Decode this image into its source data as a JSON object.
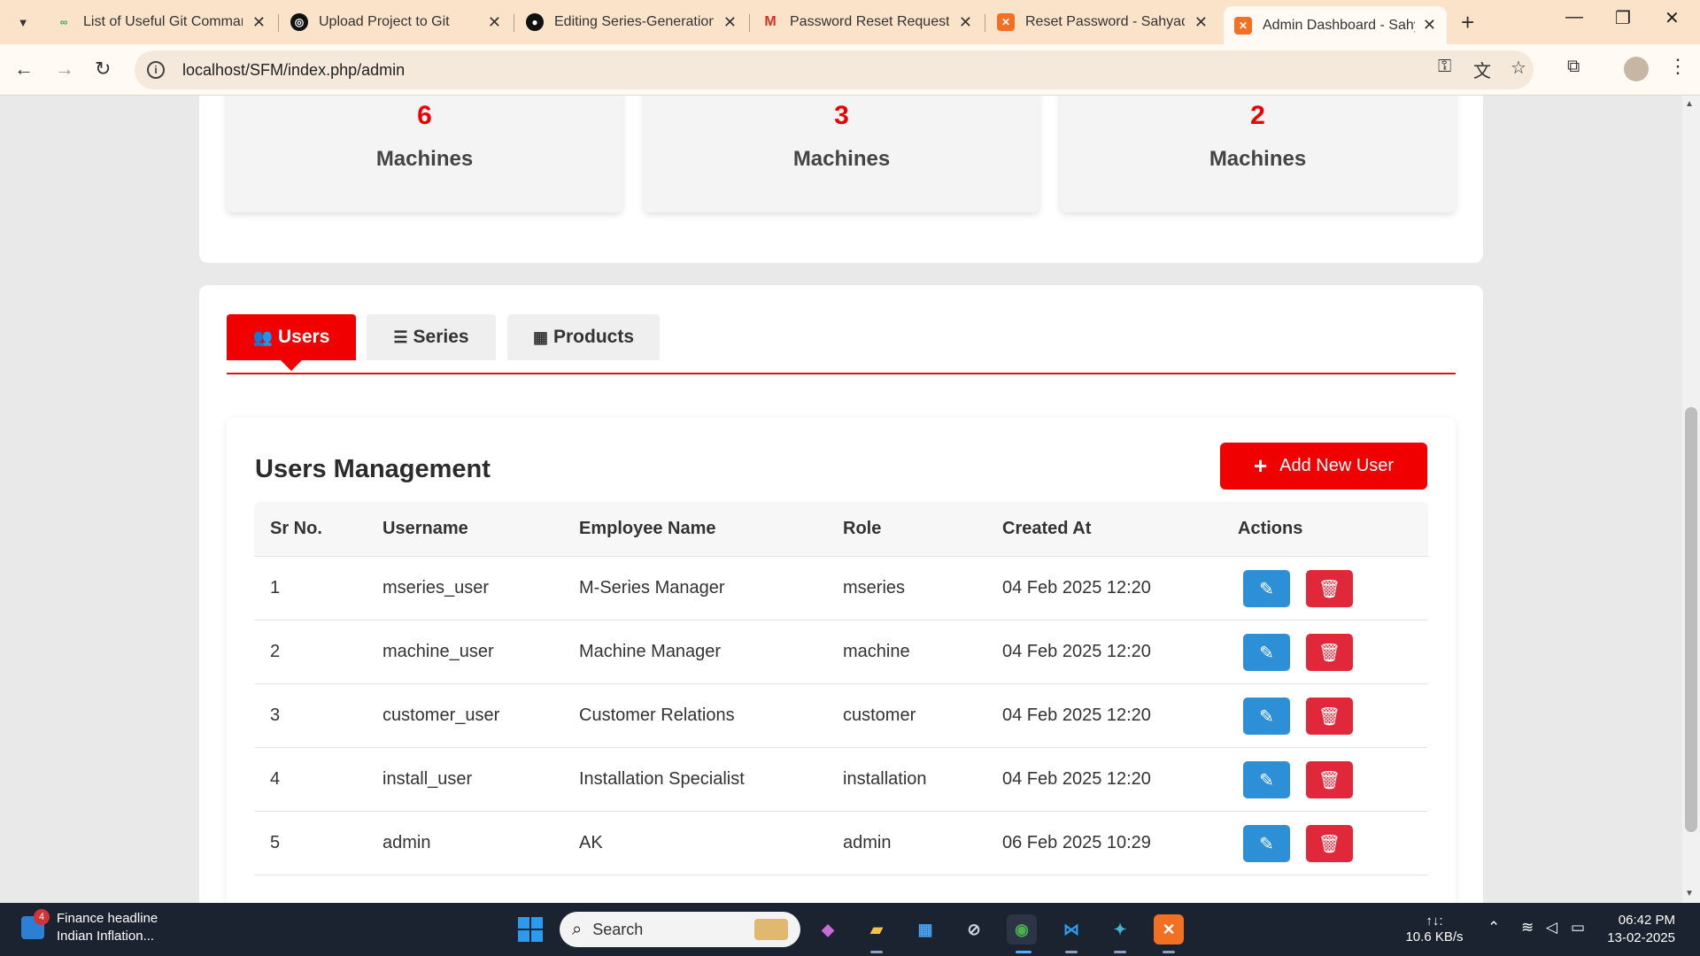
{
  "browser": {
    "tabs": [
      {
        "title": "List of Useful Git Commands",
        "favicon": "git-icon",
        "color": "#3aa35b"
      },
      {
        "title": "Upload Project to Git",
        "favicon": "openai-icon",
        "color": "#111111"
      },
      {
        "title": "Editing Series-Generation-",
        "favicon": "github-icon",
        "color": "#111111"
      },
      {
        "title": "Password Reset Request - ",
        "favicon": "gmail-icon",
        "color": "#d93025"
      },
      {
        "title": "Reset Password - Sahyadri",
        "favicon": "xampp-icon",
        "color": "#f36f21"
      },
      {
        "title": "Admin Dashboard - Sahyadri",
        "favicon": "xampp-icon",
        "color": "#f36f21",
        "active": true
      }
    ],
    "url": "localhost/SFM/index.php/admin"
  },
  "stats": [
    {
      "number": "6",
      "label": "Machines"
    },
    {
      "number": "3",
      "label": "Machines"
    },
    {
      "number": "2",
      "label": "Machines"
    }
  ],
  "page_tabs": [
    {
      "label": "Users",
      "icon": "users-icon",
      "active": true
    },
    {
      "label": "Series",
      "icon": "list-icon",
      "active": false
    },
    {
      "label": "Products",
      "icon": "box-icon",
      "active": false
    }
  ],
  "users": {
    "title": "Users Management",
    "add_button": "Add New User",
    "columns": [
      "Sr No.",
      "Username",
      "Employee Name",
      "Role",
      "Created At",
      "Actions"
    ],
    "rows": [
      {
        "sr": "1",
        "username": "mseries_user",
        "name": "M-Series Manager",
        "role": "mseries",
        "created": "04 Feb 2025 12:20"
      },
      {
        "sr": "2",
        "username": "machine_user",
        "name": "Machine Manager",
        "role": "machine",
        "created": "04 Feb 2025 12:20"
      },
      {
        "sr": "3",
        "username": "customer_user",
        "name": "Customer Relations",
        "role": "customer",
        "created": "04 Feb 2025 12:20"
      },
      {
        "sr": "4",
        "username": "install_user",
        "name": "Installation Specialist",
        "role": "installation",
        "created": "04 Feb 2025 12:20"
      },
      {
        "sr": "5",
        "username": "admin",
        "name": "AK",
        "role": "admin",
        "created": "06 Feb 2025 10:29"
      }
    ]
  },
  "taskbar": {
    "news_badge": "4",
    "news_title": "Finance headline",
    "news_text": "Indian Inflation...",
    "search_placeholder": "Search",
    "net_label": "↑↓:",
    "net_speed": "10.6 KB/s",
    "time": "06:42 PM",
    "date": "13-02-2025"
  },
  "colors": {
    "accent": "#f00000",
    "edit": "#2d8fd6",
    "delete": "#e0283a"
  }
}
